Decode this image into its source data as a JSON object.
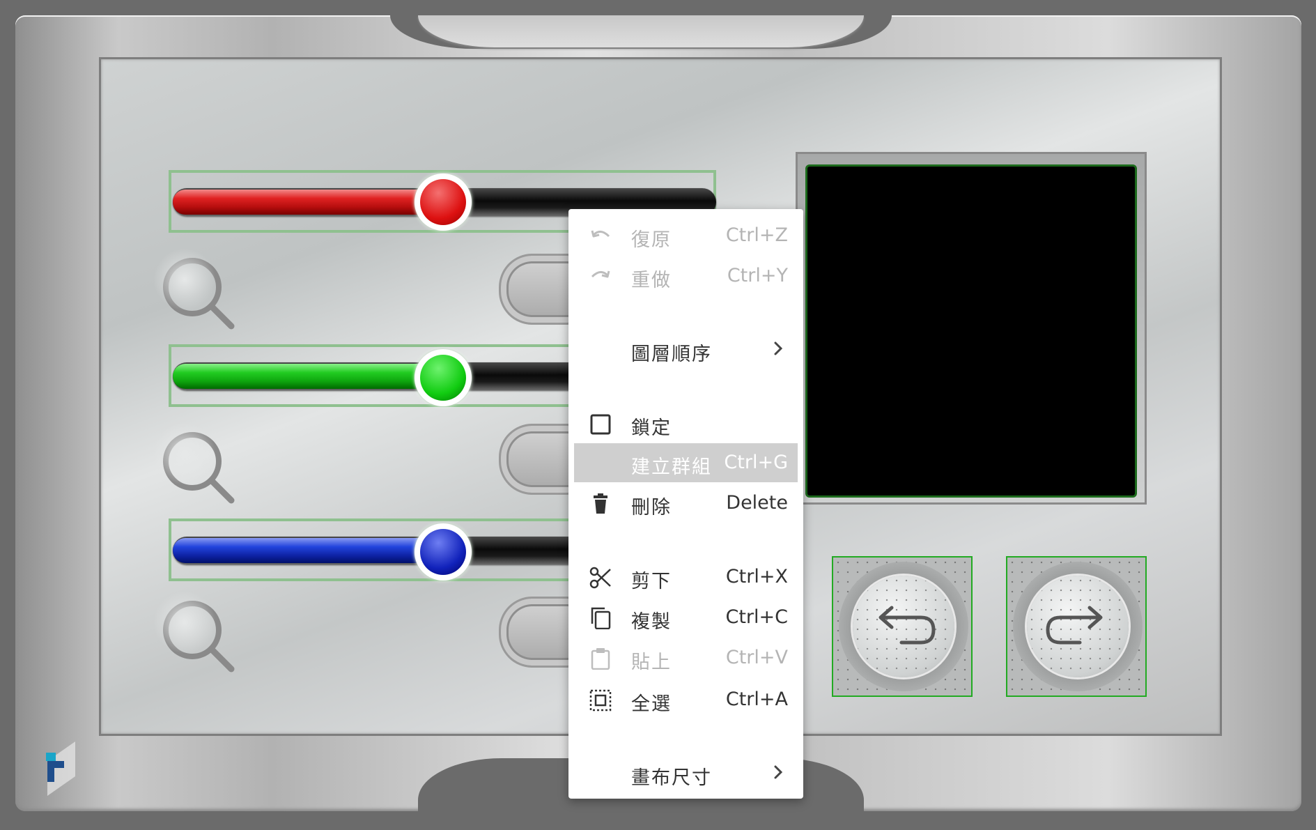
{
  "sliders": [
    {
      "name": "red",
      "value_fraction": 0.5,
      "color": "#d11111"
    },
    {
      "name": "green",
      "value_fraction": 0.5,
      "color": "#11bb11"
    },
    {
      "name": "blue",
      "value_fraction": 0.5,
      "color": "#1122bb"
    }
  ],
  "colors": {
    "selection_outline": "#8fc08f",
    "screen_border": "#1c6a1c",
    "round_button_outline": "#22aa22",
    "menu_hover": "#cfcfcf"
  },
  "context_menu": {
    "items": [
      {
        "icon": "undo-icon",
        "label": "復原",
        "shortcut": "Ctrl+Z",
        "disabled": true
      },
      {
        "icon": "redo-icon",
        "label": "重做",
        "shortcut": "Ctrl+Y",
        "disabled": true
      },
      {
        "icon": "",
        "label": "圖層順序",
        "shortcut": "",
        "submenu": true
      },
      {
        "icon": "checkbox-icon",
        "label": "鎖定",
        "shortcut": ""
      },
      {
        "icon": "",
        "label": "建立群組",
        "shortcut": "Ctrl+G",
        "highlighted": true
      },
      {
        "icon": "trash-icon",
        "label": "刪除",
        "shortcut": "Delete"
      },
      {
        "icon": "scissors-icon",
        "label": "剪下",
        "shortcut": "Ctrl+X"
      },
      {
        "icon": "copy-icon",
        "label": "複製",
        "shortcut": "Ctrl+C"
      },
      {
        "icon": "paste-icon",
        "label": "貼上",
        "shortcut": "Ctrl+V",
        "disabled": true
      },
      {
        "icon": "select-all-icon",
        "label": "全選",
        "shortcut": "Ctrl+A"
      },
      {
        "icon": "",
        "label": "畫布尺寸",
        "shortcut": "",
        "submenu": true
      }
    ]
  },
  "round_buttons": [
    {
      "icon": "undo-arrow-icon"
    },
    {
      "icon": "redo-arrow-icon"
    }
  ]
}
